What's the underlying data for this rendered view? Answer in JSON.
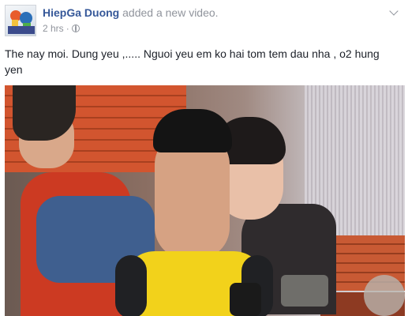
{
  "post": {
    "author": "HiepGa Duong",
    "action": "added a new video.",
    "time": "2 hrs",
    "separator": "·",
    "message": "The nay moi. Dung yeu ,..... Nguoi yeu em ko hai tom tem dau nha , o2 hung yen"
  },
  "icons": {
    "privacy": "globe-icon",
    "menu": "chevron-down-icon"
  },
  "colors": {
    "author_link": "#365899",
    "meta_gray": "#90949c",
    "text": "#1d2129"
  }
}
